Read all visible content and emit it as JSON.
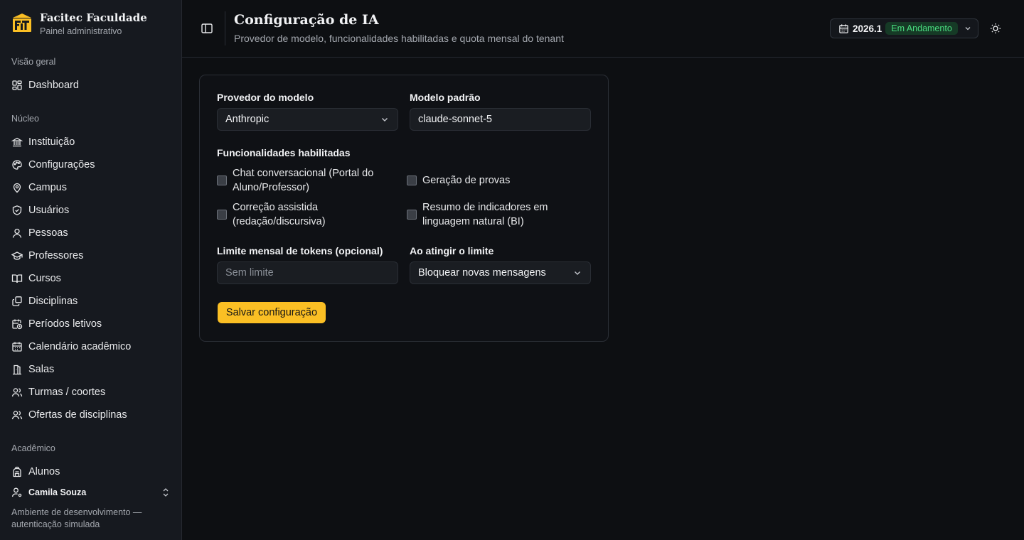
{
  "brand": {
    "title": "Facitec Faculdade",
    "subtitle": "Painel administrativo",
    "accent_color": "#fbbf24"
  },
  "sidebar": {
    "sections": {
      "overview": "Visão geral",
      "core": "Núcleo",
      "academic": "Acadêmico"
    },
    "items": [
      {
        "label": "Dashboard",
        "icon": "grid-icon"
      },
      {
        "label": "Instituição",
        "icon": "institution-icon"
      },
      {
        "label": "Configurações",
        "icon": "palette-icon"
      },
      {
        "label": "Campus",
        "icon": "map-pin-icon"
      },
      {
        "label": "Usuários",
        "icon": "shield-icon"
      },
      {
        "label": "Pessoas",
        "icon": "user-icon"
      },
      {
        "label": "Professores",
        "icon": "graduation-cap-icon"
      },
      {
        "label": "Cursos",
        "icon": "book-open-icon"
      },
      {
        "label": "Disciplinas",
        "icon": "copy-icon"
      },
      {
        "label": "Períodos letivos",
        "icon": "calendar-clock-icon"
      },
      {
        "label": "Calendário acadêmico",
        "icon": "calendar-icon"
      },
      {
        "label": "Salas",
        "icon": "door-icon"
      },
      {
        "label": "Turmas / coortes",
        "icon": "users-icon"
      },
      {
        "label": "Ofertas de disciplinas",
        "icon": "users-icon"
      },
      {
        "label": "Alunos",
        "icon": "backpack-icon"
      }
    ],
    "user": {
      "name": "Camila Souza"
    },
    "env_note": "Ambiente de desenvolvimento — autenticação simulada"
  },
  "header": {
    "title": "Configuração de IA",
    "subtitle": "Provedor de modelo, funcionalidades habilitadas e quota mensal do tenant",
    "period": {
      "value": "2026.1",
      "status": "Em Andamento",
      "status_color": "#4ade80"
    }
  },
  "form": {
    "provider": {
      "label": "Provedor do modelo",
      "value": "Anthropic"
    },
    "model": {
      "label": "Modelo padrão",
      "value": "claude-sonnet-5"
    },
    "features": {
      "label": "Funcionalidades habilitadas",
      "items": [
        {
          "label": "Chat conversacional (Portal do Aluno/Professor)",
          "checked": false
        },
        {
          "label": "Geração de provas",
          "checked": false
        },
        {
          "label": "Correção assistida (redação/discursiva)",
          "checked": false
        },
        {
          "label": "Resumo de indicadores em linguagem natural (BI)",
          "checked": false
        }
      ]
    },
    "token_limit": {
      "label": "Limite mensal de tokens (opcional)",
      "placeholder": "Sem limite",
      "value": ""
    },
    "on_limit": {
      "label": "Ao atingir o limite",
      "value": "Bloquear novas mensagens"
    },
    "save_label": "Salvar configuração"
  }
}
